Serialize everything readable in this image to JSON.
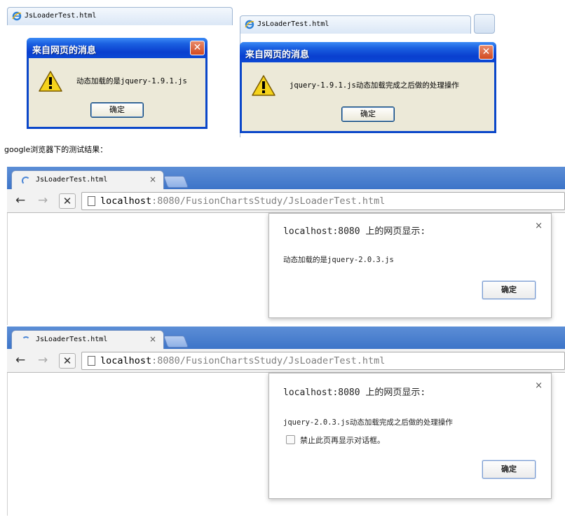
{
  "ie": {
    "tab_title": "JsLoaderTest.html",
    "dialogs": [
      {
        "title": "来自网页的消息",
        "message": "动态加载的是jquery-1.9.1.js",
        "ok_label": "确定"
      },
      {
        "title": "来自网页的消息",
        "message": "jquery-1.9.1.js动态加载完成之后做的处理操作",
        "ok_label": "确定"
      }
    ],
    "close_glyph": "✕",
    "warning_icon": "warning-icon"
  },
  "caption": "google浏览器下的测试结果：",
  "chrome": {
    "windows": [
      {
        "tab_title": "JsLoaderTest.html",
        "tab_close": "×",
        "url_host": "localhost",
        "url_rest": ":8080/FusionChartsStudy/JsLoaderTest.html",
        "dialog_title": "localhost:8080 上的网页显示:",
        "dialog_close": "×",
        "dialog_message": "动态加载的是jquery-2.0.3.js",
        "ok_label": "确定"
      },
      {
        "tab_title": "JsLoaderTest.html",
        "tab_close": "×",
        "url_host": "localhost",
        "url_rest": ":8080/FusionChartsStudy/JsLoaderTest.html",
        "dialog_title": "localhost:8080 上的网页显示:",
        "dialog_close": "×",
        "dialog_message": "jquery-2.0.3.js动态加载完成之后做的处理操作",
        "checkbox_label": "禁止此页再显示对话框。",
        "ok_label": "确定"
      }
    ],
    "nav": {
      "back": "←",
      "forward": "→",
      "stop": "✕"
    }
  },
  "colors": {
    "xp_title_blue": "#0b48d4",
    "xp_dialog_bg": "#ece9d8",
    "chrome_frame_blue": "#3d74c8"
  }
}
